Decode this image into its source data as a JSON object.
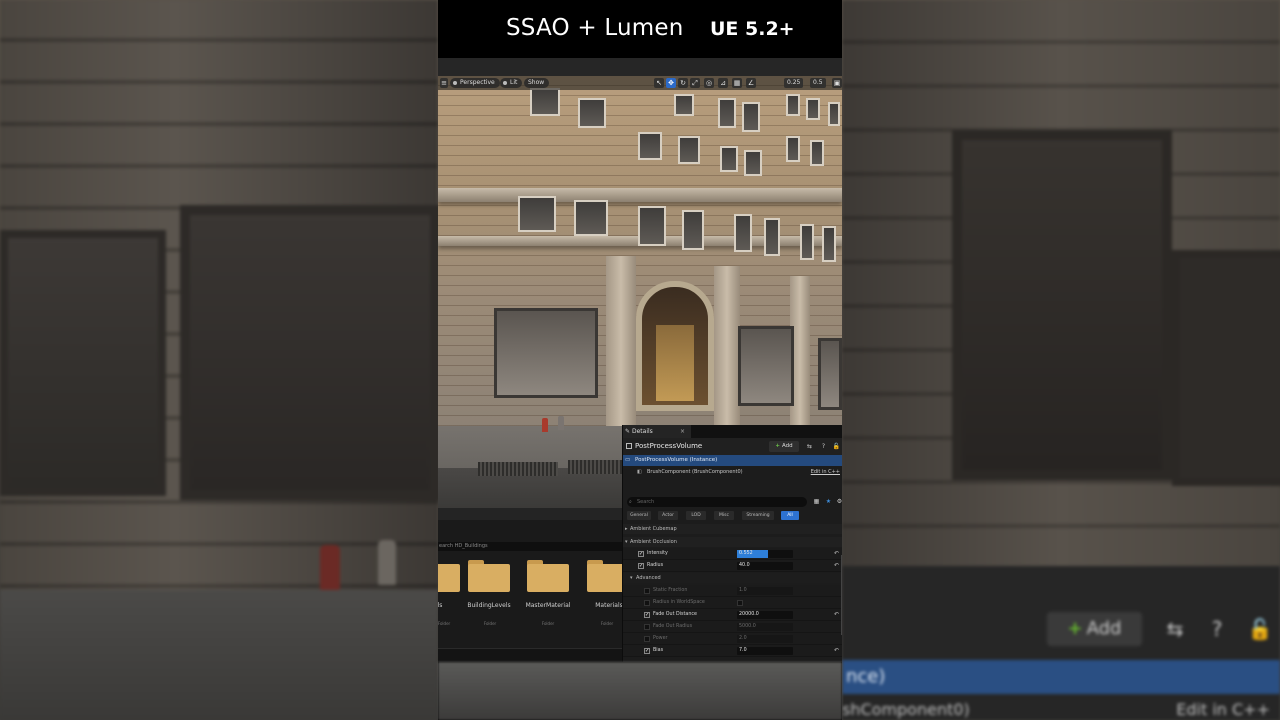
{
  "overlay": {
    "title": "SSAO + Lumen",
    "version": "UE 5.2+"
  },
  "viewport": {
    "mode_label": "Perspective",
    "lit_label": "Lit",
    "show_label": "Show",
    "snap_scale": "0.25",
    "snap_rot": "0.5"
  },
  "content_browser": {
    "search_placeholder": "earch HD_Buildings",
    "folders": [
      {
        "name": "ls",
        "type": "Folder"
      },
      {
        "name": "BuildingLevels",
        "type": "Folder"
      },
      {
        "name": "MasterMaterial",
        "type": "Folder"
      },
      {
        "name": "Materials",
        "type": "Folder"
      }
    ]
  },
  "details": {
    "tab_label": "Details",
    "actor_name": "PostProcessVolume",
    "add_label": "Add",
    "instance_label": "PostProcessVolume (Instance)",
    "component_label": "BrushComponent (BrushComponent0)",
    "edit_cpp": "Edit in C++",
    "search_placeholder": "Search",
    "filters": [
      "General",
      "Actor",
      "LOD",
      "Misc",
      "Streaming",
      "All"
    ],
    "active_filter": "All",
    "categories": {
      "ambient_cubemap": "Ambient Cubemap",
      "ambient_occlusion": "Ambient Occlusion",
      "advanced": "Advanced"
    },
    "properties": {
      "intensity": {
        "label": "Intensity",
        "value": "0.552",
        "level": 0.552
      },
      "radius": {
        "label": "Radius",
        "value": "40.0"
      },
      "static_fraction": {
        "label": "Static Fraction",
        "value": "1.0"
      },
      "radius_in_worldspace": {
        "label": "Radius in WorldSpace"
      },
      "fade_out_distance": {
        "label": "Fade Out Distance",
        "value": "20000.0"
      },
      "fade_out_radius": {
        "label": "Fade Out Radius",
        "value": "5000.0"
      },
      "power": {
        "label": "Power",
        "value": "2.0"
      },
      "bias": {
        "label": "Bias",
        "value": "7.0"
      }
    }
  },
  "background": {
    "add_label": "Add",
    "instance_fragment": "nce)",
    "component_fragment": "shComponent0)",
    "edit_cpp": "Edit in C++"
  },
  "colors": {
    "accent": "#2d72d2",
    "selection": "#244a7e",
    "folder": "#d9ae62",
    "add_plus": "#6cc24a"
  }
}
